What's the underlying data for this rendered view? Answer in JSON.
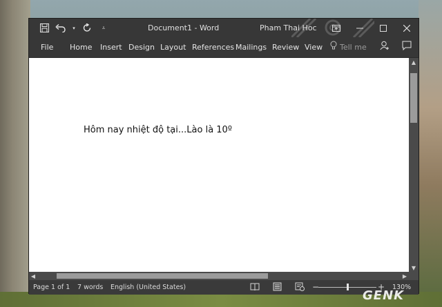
{
  "window": {
    "document_title": "Document1  -  Word",
    "user_name": "Pham Thai Hoc"
  },
  "quick_access": {
    "icons": [
      "save-icon",
      "undo-icon",
      "redo-icon",
      "customize-icon"
    ]
  },
  "ribbon": {
    "tabs": [
      "File",
      "Home",
      "Insert",
      "Design",
      "Layout",
      "References",
      "Mailings",
      "Review",
      "View"
    ],
    "tell_me": "Tell me"
  },
  "document": {
    "text": "Hôm nay nhiệt độ tại...Lào là 10º"
  },
  "status": {
    "page": "Page 1 of 1",
    "words": "7 words",
    "language": "English (United States)",
    "zoom": "130%",
    "zoom_level_percent": 130
  },
  "watermark": "GENK",
  "colors": {
    "titlebar": "#373737",
    "statusbar": "#3a3a3a",
    "page": "#ffffff"
  }
}
